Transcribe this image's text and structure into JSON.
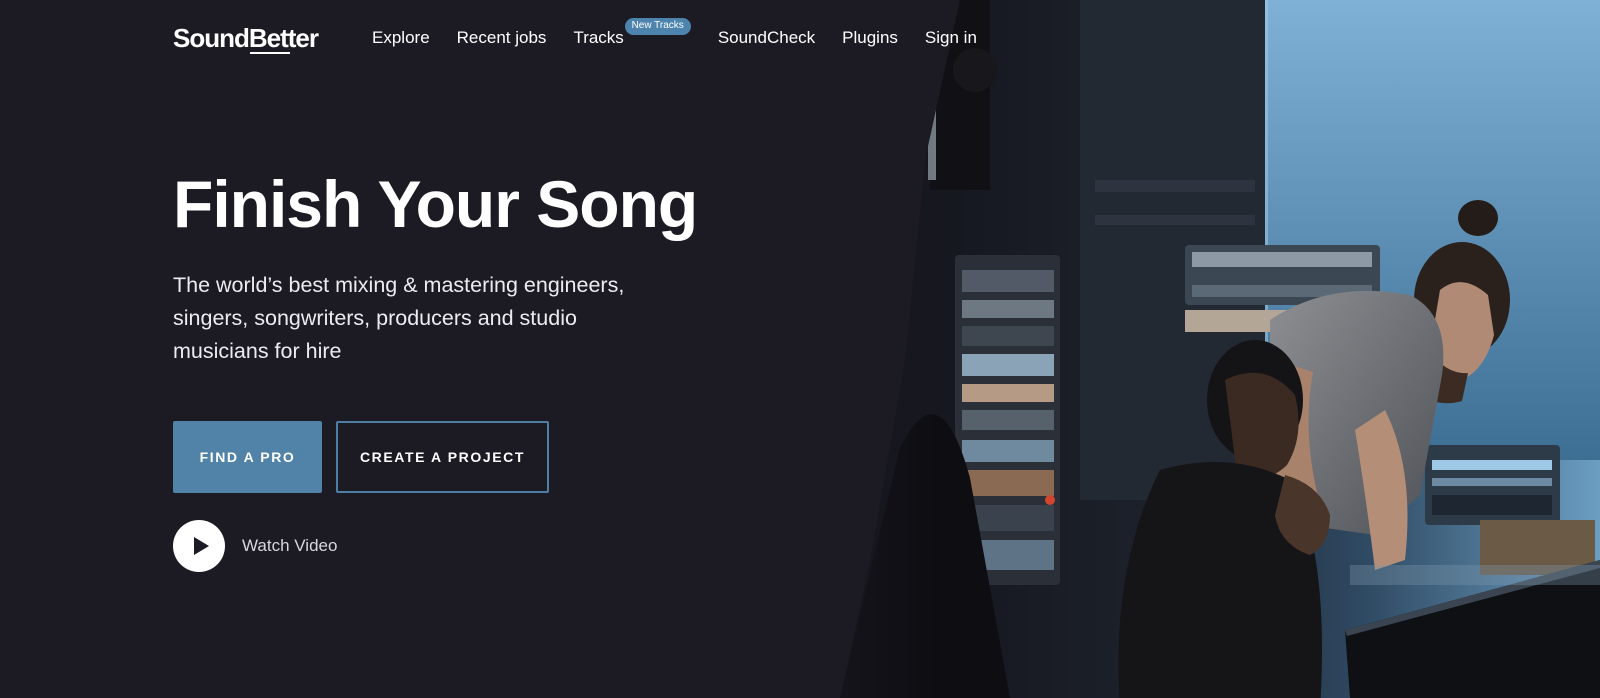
{
  "brand": {
    "logo_sound": "Sound",
    "logo_better": "Better"
  },
  "nav": {
    "items": [
      {
        "label": "Explore"
      },
      {
        "label": "Recent jobs"
      },
      {
        "label": "Tracks",
        "badge": "New Tracks"
      },
      {
        "label": "SoundCheck"
      },
      {
        "label": "Plugins"
      },
      {
        "label": "Sign in"
      }
    ]
  },
  "hero": {
    "title": "Finish Your Song",
    "subtitle": "The world’s best mixing & mastering engineers, singers, songwriters, producers and studio musicians for hire"
  },
  "actions": {
    "find_pro": "FIND A PRO",
    "create_project": "CREATE A PROJECT",
    "watch_video": "Watch Video"
  },
  "colors": {
    "background": "#1c1b24",
    "accent": "#5182a8",
    "badge": "#4d84ad"
  },
  "icons": {
    "play": "play-icon"
  },
  "image": {
    "description_icon": "hero-studio-photo"
  }
}
